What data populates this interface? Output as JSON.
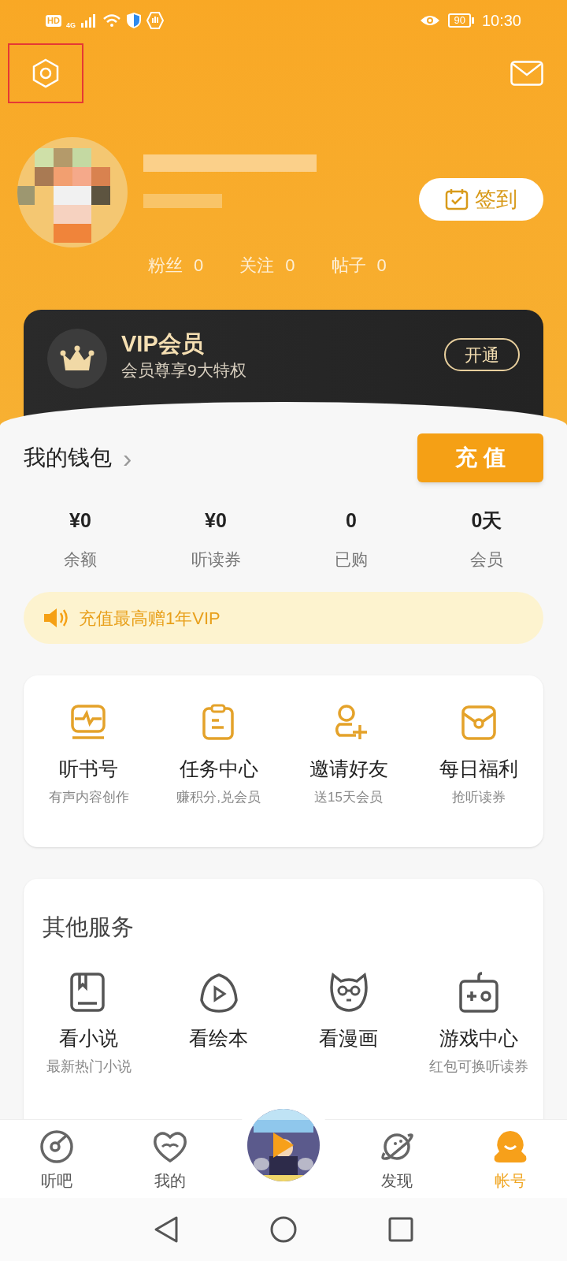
{
  "status_bar": {
    "left": [
      "HD",
      "4G"
    ],
    "battery": "90",
    "time": "10:30"
  },
  "header": {
    "settings_highlighted": true
  },
  "profile": {
    "sign_in": "签到",
    "stats": [
      {
        "label": "粉丝",
        "value": "0"
      },
      {
        "label": "关注",
        "value": "0"
      },
      {
        "label": "帖子",
        "value": "0"
      }
    ]
  },
  "vip": {
    "title": "VIP会员",
    "subtitle": "会员尊享9大特权",
    "button": "开通"
  },
  "wallet": {
    "title": "我的钱包",
    "chevron": "›",
    "recharge": "充 值",
    "items": [
      {
        "value": "¥0",
        "label": "余额"
      },
      {
        "value": "¥0",
        "label": "听读券"
      },
      {
        "value": "0",
        "label": "已购"
      },
      {
        "value": "0天",
        "label": "会员"
      }
    ]
  },
  "promo": {
    "text": "充值最高赠1年VIP"
  },
  "features": [
    {
      "title": "听书号",
      "subtitle": "有声内容创作"
    },
    {
      "title": "任务中心",
      "subtitle": "赚积分,兑会员"
    },
    {
      "title": "邀请好友",
      "subtitle": "送15天会员"
    },
    {
      "title": "每日福利",
      "subtitle": "抢听读券"
    }
  ],
  "other_services": {
    "title": "其他服务",
    "items": [
      {
        "title": "看小说",
        "subtitle": "最新热门小说"
      },
      {
        "title": "看绘本"
      },
      {
        "title": "看漫画"
      },
      {
        "title": "游戏中心",
        "subtitle": "红包可换听读券"
      }
    ]
  },
  "bottom_nav": [
    {
      "label": "听吧",
      "selected": false
    },
    {
      "label": "我的",
      "selected": false
    },
    {
      "kind": "player"
    },
    {
      "label": "发现",
      "selected": false
    },
    {
      "label": "帐号",
      "selected": true
    }
  ]
}
